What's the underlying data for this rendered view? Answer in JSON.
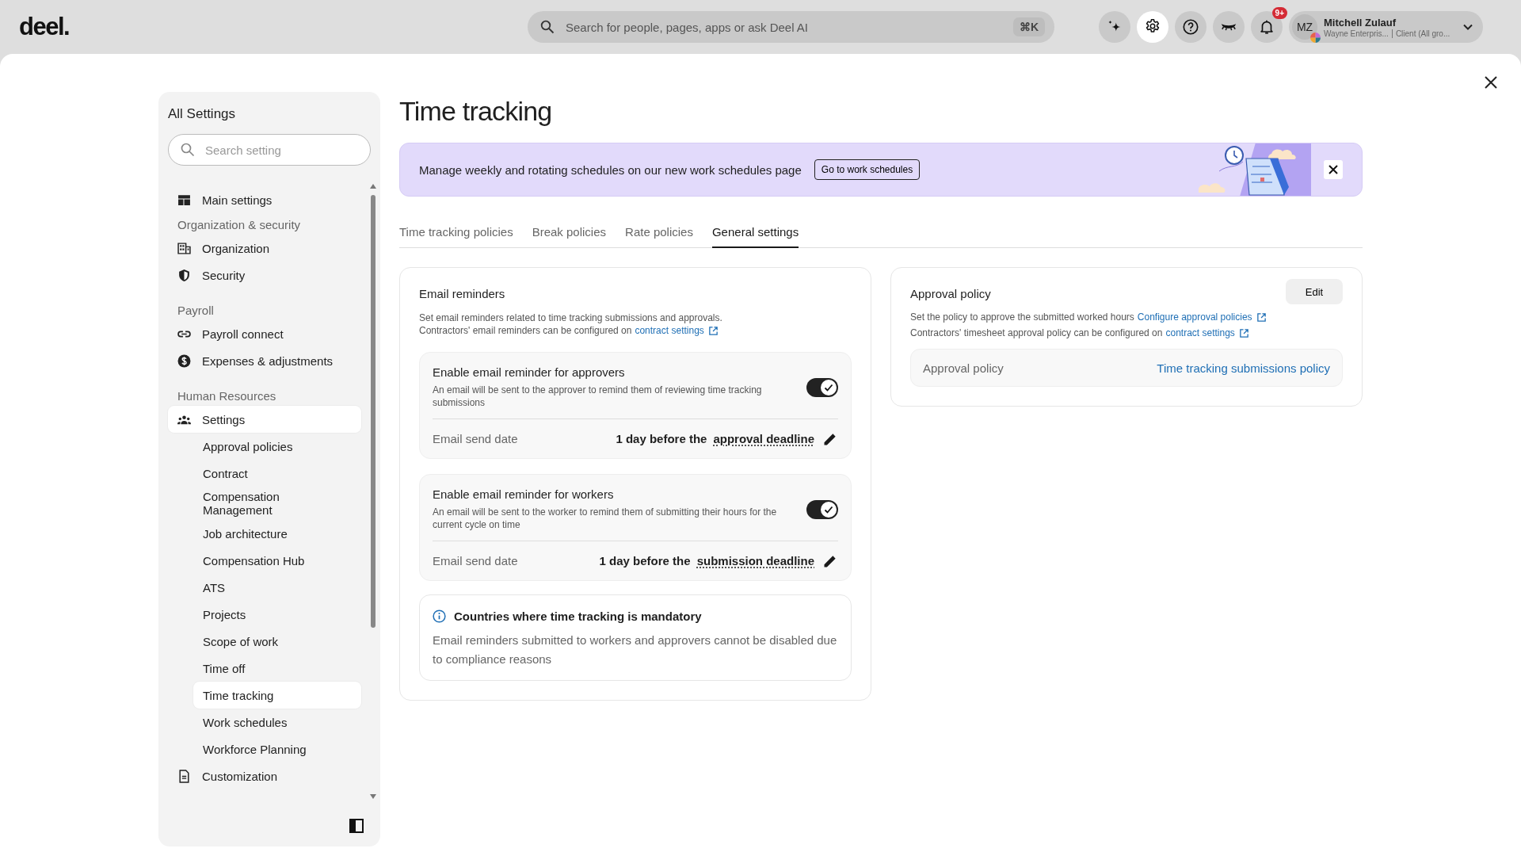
{
  "topbar": {
    "logo": "deel.",
    "search": {
      "placeholder": "Search for people, pages, apps or ask Deel AI",
      "shortcut": "⌘K"
    },
    "buttons": [
      {
        "selected": false
      },
      {
        "selected": true
      },
      {
        "selected": false
      },
      {
        "selected": false
      },
      {
        "selected": false,
        "badge": "9+"
      }
    ],
    "user": {
      "initials": "MZ",
      "name": "Mitchell Zulauf",
      "org": "Wayne Enterpris...",
      "role": "Client (All gro..."
    }
  },
  "sidebar": {
    "title": "All Settings",
    "search": {
      "placeholder": "Search setting"
    },
    "items": [
      {
        "kind": "item",
        "label": "Main settings",
        "selected": false
      },
      {
        "kind": "heading",
        "label": "Organization & security"
      },
      {
        "kind": "item",
        "label": "Organization",
        "selected": false
      },
      {
        "kind": "item",
        "label": "Security",
        "selected": false
      },
      {
        "kind": "heading",
        "label": "Payroll"
      },
      {
        "kind": "item",
        "label": "Payroll connect",
        "selected": false
      },
      {
        "kind": "item",
        "label": "Expenses & adjustments",
        "selected": false
      },
      {
        "kind": "heading",
        "label": "Human Resources"
      },
      {
        "kind": "item",
        "label": "Settings",
        "selected": true,
        "children": [
          {
            "label": "Approval policies",
            "selected": false
          },
          {
            "label": "Contract",
            "selected": false
          },
          {
            "label": "Compensation Management",
            "selected": false
          },
          {
            "label": "Job architecture",
            "selected": false
          },
          {
            "label": "Compensation Hub",
            "selected": false
          },
          {
            "label": "ATS",
            "selected": false
          },
          {
            "label": "Projects",
            "selected": false
          },
          {
            "label": "Scope of work",
            "selected": false
          },
          {
            "label": "Time off",
            "selected": false
          },
          {
            "label": "Time tracking",
            "selected": true
          },
          {
            "label": "Work schedules",
            "selected": false
          },
          {
            "label": "Workforce Planning",
            "selected": false
          }
        ]
      },
      {
        "kind": "item",
        "label": "Customization",
        "selected": false
      }
    ]
  },
  "page": {
    "title": "Time tracking"
  },
  "banner": {
    "text": "Manage weekly and rotating schedules on our new work schedules page",
    "button": "Go to work schedules"
  },
  "tabs": [
    {
      "label": "Time tracking policies",
      "selected": false
    },
    {
      "label": "Break policies",
      "selected": false
    },
    {
      "label": "Rate policies",
      "selected": false
    },
    {
      "label": "General settings",
      "selected": true
    }
  ],
  "email_reminders": {
    "title": "Email reminders",
    "description": "Set email reminders related to time tracking submissions and approvals.",
    "contractor_text": "Contractors' email reminders can be configured on",
    "contractor_link": "contract settings",
    "reminders": [
      {
        "title": "Enable email reminder for approvers",
        "description": "An email will be sent to the approver to remind them of reviewing time tracking submissions",
        "on": true,
        "date_label": "Email send date",
        "date_prefix": "1 day before the",
        "date_link": "approval deadline"
      },
      {
        "title": "Enable email reminder for workers",
        "description": "An email will be sent to the worker to remind them of submitting their hours for the current cycle on time",
        "on": true,
        "date_label": "Email send date",
        "date_prefix": "1 day before the",
        "date_link": "submission deadline"
      }
    ],
    "notice": {
      "title": "Countries where time tracking is mandatory",
      "text": "Email reminders submitted to workers and approvers cannot be disabled due to compliance reasons"
    }
  },
  "approval_policy": {
    "title": "Approval policy",
    "edit_button": "Edit",
    "lines": [
      {
        "text": "Set the policy to approve the submitted worked hours",
        "link": "Configure approval policies"
      },
      {
        "text": "Contractors' timesheet approval policy can be configured on",
        "link": "contract settings"
      }
    ],
    "field": {
      "label": "Approval policy",
      "value": "Time tracking submissions policy"
    }
  }
}
